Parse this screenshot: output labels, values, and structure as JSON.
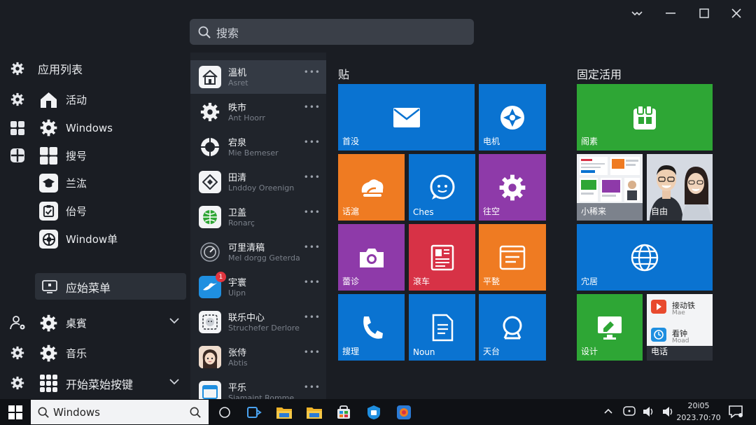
{
  "search": {
    "label": "搜索"
  },
  "left": {
    "header": "应用列表",
    "items": [
      {
        "label": "活动"
      },
      {
        "label": "Windows"
      },
      {
        "label": "搜号"
      },
      {
        "label": "兰汯"
      },
      {
        "label": "佁号"
      },
      {
        "label": "Window单"
      }
    ],
    "selected": "应始菜单",
    "bottom": [
      {
        "label": "桌賓"
      },
      {
        "label": "音乐"
      },
      {
        "label": "开始菜始按键"
      }
    ]
  },
  "apps": [
    {
      "name": "溫机",
      "sub": "Asret"
    },
    {
      "name": "昳市",
      "sub": "Ant Hoorr"
    },
    {
      "name": "宕泉",
      "sub": "Mie Bemeser"
    },
    {
      "name": "田清",
      "sub": "Lnddoy Oreenign"
    },
    {
      "name": "卫盖",
      "sub": "Ronarç"
    },
    {
      "name": "可里清稿",
      "sub": "Mel dorgg Geterda"
    },
    {
      "name": "宇寰",
      "sub": "Uipn",
      "badge": "1"
    },
    {
      "name": "联乐中心",
      "sub": "Struchefer Derlore"
    },
    {
      "name": "张侍",
      "sub": "Abtis"
    },
    {
      "name": "平乐",
      "sub": "Siamaint Romme"
    }
  ],
  "tiles": {
    "section1": "贴",
    "section2": "固定活用",
    "labels": {
      "mail": "首没",
      "maps": "电机",
      "weather": "话滬",
      "chat": "Ches",
      "settings": "往空",
      "camera": "蕾诊",
      "news": "滾车",
      "notes": "平甃",
      "phone": "搜理",
      "doc": "Noun",
      "search": "天台",
      "store": "阁素",
      "photos": "小稀来",
      "people": "自由",
      "web": "宂居",
      "design": "设计",
      "mini": "电话",
      "mini1": "接动铁",
      "mini1sub": "Mae",
      "mini2": "看钟",
      "mini2sub": "Moad"
    }
  },
  "taskbar": {
    "search": "Windows",
    "time": "20i05",
    "date": "2023.70:70"
  },
  "colors": {
    "blue": "#0a73d1",
    "orange": "#ef7b22",
    "purple": "#8e3aa9",
    "red": "#d73246",
    "green": "#2ea635"
  }
}
